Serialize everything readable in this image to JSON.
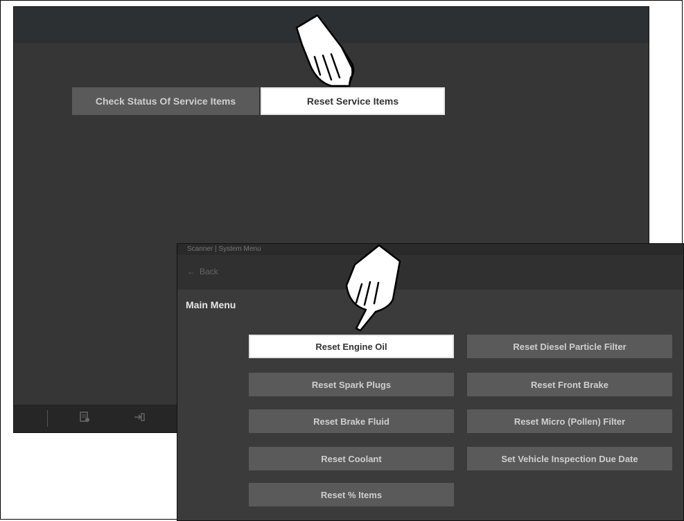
{
  "screen1": {
    "buttons": {
      "check_status": "Check Status Of Service Items",
      "reset_service": "Reset Service Items"
    }
  },
  "screen2": {
    "breadcrumb": "Scanner | System Menu",
    "back_label": "Back",
    "heading": "Main Menu",
    "menu": [
      {
        "label": "Reset Engine Oil",
        "selected": true
      },
      {
        "label": "Reset Diesel Particle Filter"
      },
      {
        "label": "Reset Spark Plugs"
      },
      {
        "label": "Reset Front Brake"
      },
      {
        "label": "Reset Brake Fluid"
      },
      {
        "label": "Reset Micro (Pollen) Filter"
      },
      {
        "label": "Reset Coolant"
      },
      {
        "label": "Set Vehicle Inspection Due Date"
      },
      {
        "label": "Reset % Items"
      }
    ]
  },
  "icons": [
    "pointing-hand-icon",
    "back-arrow-icon",
    "report-icon",
    "exit-icon"
  ],
  "colors": {
    "background": "#363636",
    "button": "#5a5a5a",
    "selected": "#ffffff"
  }
}
